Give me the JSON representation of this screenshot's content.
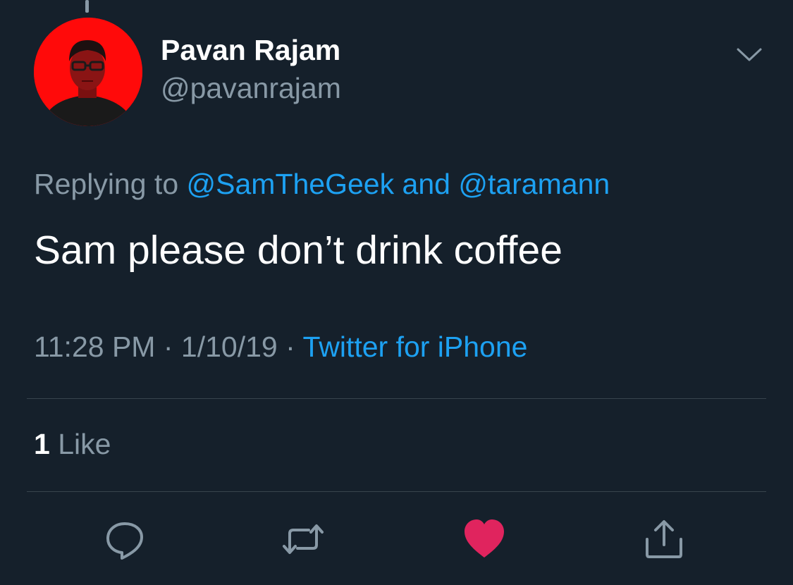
{
  "author": {
    "display_name": "Pavan Rajam",
    "handle": "@pavanrajam"
  },
  "reply": {
    "prefix": "Replying to",
    "mention_1": "@SamTheGeek",
    "conjunction": "and",
    "mention_2": "@taramann"
  },
  "tweet": {
    "text": "Sam please don’t drink coffee",
    "time": "11:28 PM",
    "date": "1/10/19",
    "separator": "·",
    "source": "Twitter for iPhone"
  },
  "stats": {
    "like_count": "1",
    "like_label": "Like"
  },
  "actions": {
    "reply_icon": "reply-icon",
    "retweet_icon": "retweet-icon",
    "like_icon": "heart-icon",
    "share_icon": "share-icon"
  },
  "colors": {
    "background": "#15202b",
    "link": "#1da1f2",
    "secondary_text": "#8899a6",
    "liked_heart": "#e0245e",
    "divider": "#38444d",
    "avatar_background": "#ff0a0a"
  }
}
